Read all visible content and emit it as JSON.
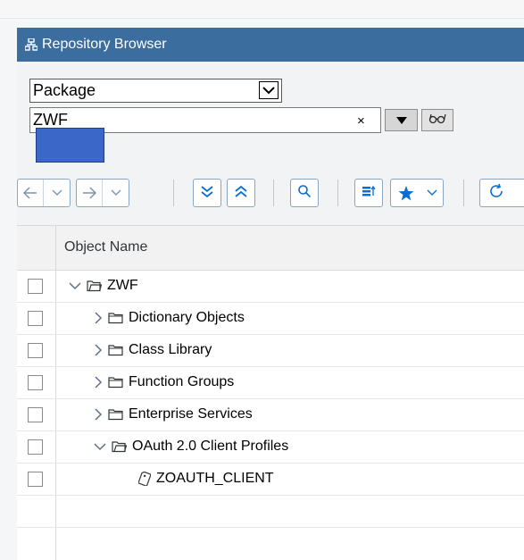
{
  "title": "Repository Browser",
  "filter": {
    "object_type_selected": "Package",
    "object_name_value": "ZWF",
    "clear_symbol": "×"
  },
  "table": {
    "column_header": "Object Name",
    "rows": [
      {
        "label": "ZWF",
        "expander": "chevron-down-icon",
        "icon": "folder-open-icon"
      },
      {
        "label": "Dictionary Objects",
        "expander": "chevron-right-icon",
        "icon": "folder-icon"
      },
      {
        "label": "Class Library",
        "expander": "chevron-right-icon",
        "icon": "folder-icon"
      },
      {
        "label": "Function Groups",
        "expander": "chevron-right-icon",
        "icon": "folder-icon"
      },
      {
        "label": "Enterprise Services",
        "expander": "chevron-right-icon",
        "icon": "folder-icon"
      },
      {
        "label": "OAuth 2.0 Client Profiles",
        "expander": "chevron-down-icon",
        "icon": "folder-open-icon"
      },
      {
        "label": "ZOAUTH_CLIENT",
        "expander": "",
        "icon": "document-tag-icon"
      }
    ]
  },
  "colors": {
    "title_bar": "#3b6e9f",
    "accent": "#0a6ed1",
    "redaction": "#3a67c8"
  }
}
